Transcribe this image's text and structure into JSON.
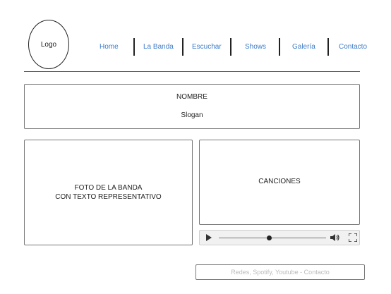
{
  "header": {
    "logo_label": "Logo",
    "nav": {
      "home": "Home",
      "la_banda": "La Banda",
      "escuchar": "Escuchar",
      "shows": "Shows",
      "galeria": "Galería",
      "contacto": "Contacto"
    },
    "link_color": "#3d7cc9"
  },
  "hero": {
    "title": "NOMBRE",
    "slogan": "Slogan"
  },
  "photo": {
    "line1": "FOTO DE LA BANDA",
    "line2": "CON TEXTO REPRESENTATIVO"
  },
  "songs": {
    "label": "CANCIONES"
  },
  "player": {
    "progress": 0.47,
    "play_icon": "play-icon",
    "volume_icon": "volume-icon",
    "fullscreen_icon": "fullscreen-icon"
  },
  "footer": {
    "text": "Redes, Spotify, Youtube - Contacto"
  }
}
